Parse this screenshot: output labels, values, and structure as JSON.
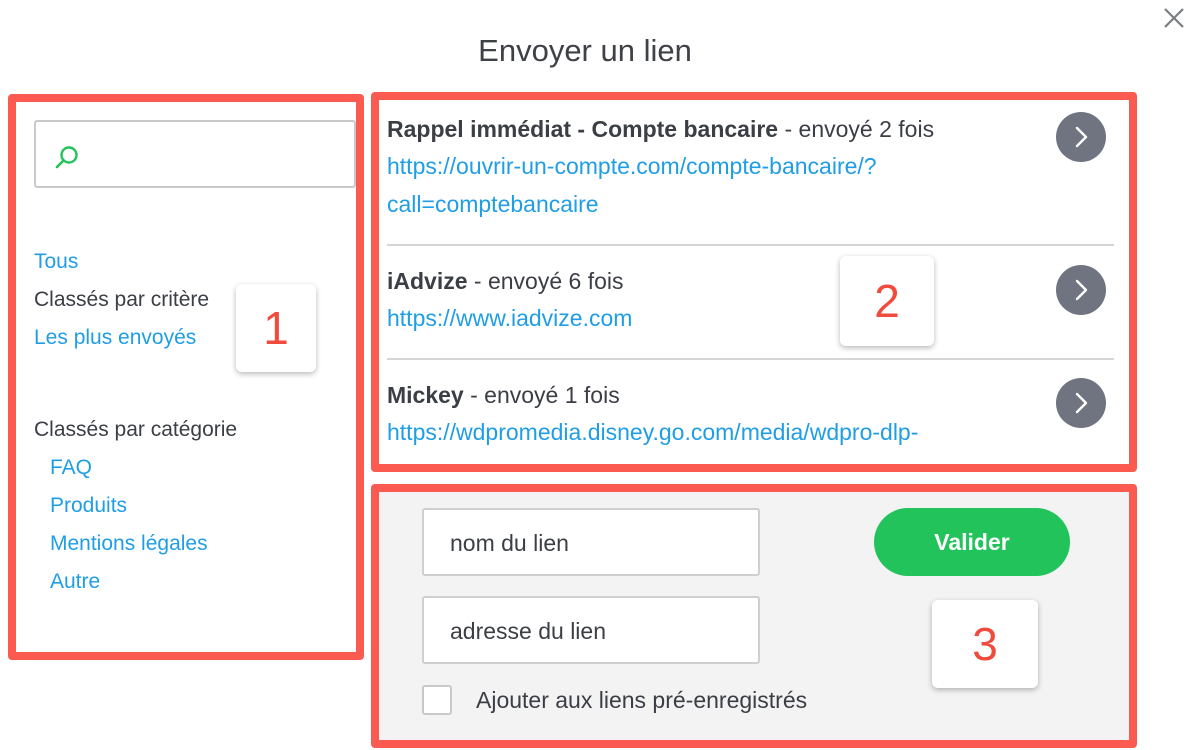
{
  "dialog": {
    "title": "Envoyer un lien",
    "close_icon": "close-icon"
  },
  "sidebar": {
    "search": {
      "placeholder": "",
      "value": "",
      "icon": "search-icon"
    },
    "all_label": "Tous",
    "criteria_heading": "Classés par critère",
    "most_sent_label": "Les plus envoyés",
    "category_heading": "Classés par catégorie",
    "categories": [
      "FAQ",
      "Produits",
      "Mentions légales",
      "Autre"
    ]
  },
  "links": [
    {
      "name": "Rappel immédiat - Compte bancaire",
      "sent": " - envoyé 2 fois",
      "url_line1": "https://ouvrir-un-compte.com/compte-bancaire/?",
      "url_line2": "call=comptebancaire"
    },
    {
      "name": "iAdvize",
      "sent": " - envoyé 6 fois",
      "url_line1": "https://www.iadvize.com"
    },
    {
      "name": "Mickey",
      "sent": " - envoyé 1 fois",
      "url_line1": "https://wdpromedia.disney.go.com/media/wdpro-dlp-"
    }
  ],
  "form": {
    "name_placeholder": "nom du lien",
    "address_placeholder": "adresse du lien",
    "submit_label": "Valider",
    "save_label": "Ajouter aux liens pré-enregistrés",
    "save_checked": false
  },
  "annotations": [
    "1",
    "2",
    "3"
  ],
  "colors": {
    "accent_link": "#1f9ee6",
    "highlight_border": "#fa5a50",
    "submit_green": "#22c35a",
    "arrow_button": "#6f7480",
    "annotation_number": "#f04b3d"
  }
}
